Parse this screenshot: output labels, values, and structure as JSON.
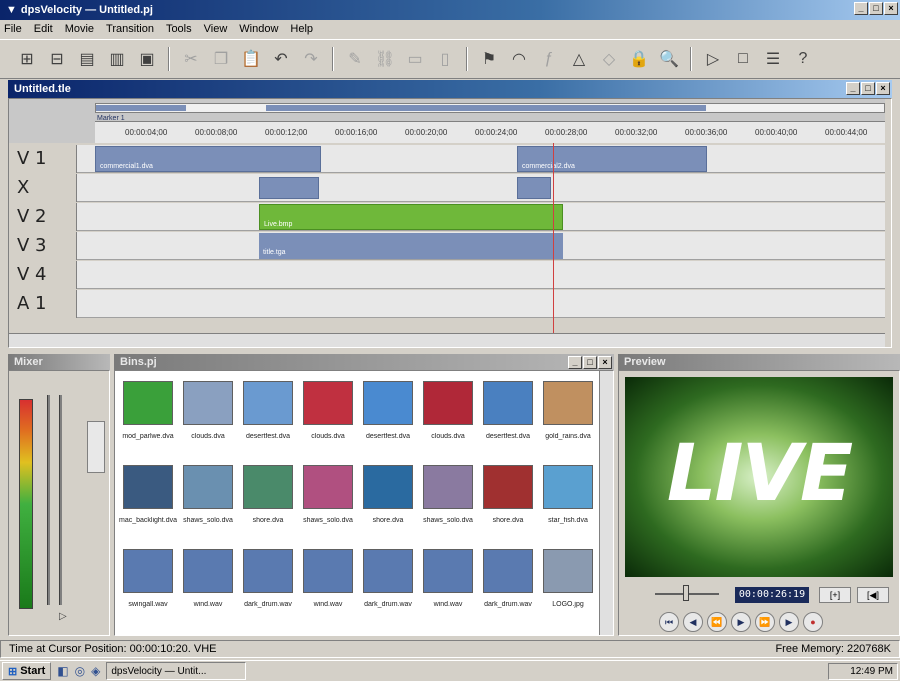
{
  "app": {
    "title": "dpsVelocity — Untitled.pj",
    "menus": [
      "File",
      "Edit",
      "Movie",
      "Transition",
      "Tools",
      "View",
      "Window",
      "Help"
    ]
  },
  "timeline": {
    "title": "Untitled.tle",
    "marker_label": "Marker 1",
    "ruler_ticks": [
      "00:00:04;00",
      "00:00:08;00",
      "00:00:12;00",
      "00:00:16;00",
      "00:00:20;00",
      "00:00:24;00",
      "00:00:28;00",
      "00:00:32;00",
      "00:00:36;00",
      "00:00:40;00",
      "00:00:44;00"
    ],
    "tracks": [
      {
        "label": "V 1"
      },
      {
        "label": "X"
      },
      {
        "label": "V 2"
      },
      {
        "label": "V 3"
      },
      {
        "label": "V 4"
      },
      {
        "label": "A 1"
      }
    ],
    "clips": {
      "v1_a": "commercial1.dva",
      "v1_b": "commercial2.dva",
      "v2": "Live.bmp",
      "v3": "title.tga"
    }
  },
  "mixer": {
    "title": "Mixer"
  },
  "bin": {
    "title": "Bins.pj",
    "items": [
      {
        "caption": "mod_parlwe.dva",
        "color": "#3aa03a"
      },
      {
        "caption": "clouds.dva",
        "color": "#8aa0c0"
      },
      {
        "caption": "desertfest.dva",
        "color": "#6a9ad0"
      },
      {
        "caption": "clouds.dva",
        "color": "#c03040"
      },
      {
        "caption": "desertfest.dva",
        "color": "#4a8ad0"
      },
      {
        "caption": "clouds.dva",
        "color": "#b02838"
      },
      {
        "caption": "desertfest.dva",
        "color": "#4a80c0"
      },
      {
        "caption": "gold_rains.dva",
        "color": "#c09060"
      },
      {
        "caption": "mac_backlight.dva",
        "color": "#3a5a80"
      },
      {
        "caption": "shaws_solo.dva",
        "color": "#6a90b0"
      },
      {
        "caption": "shore.dva",
        "color": "#4a8a6a"
      },
      {
        "caption": "shaws_solo.dva",
        "color": "#b05080"
      },
      {
        "caption": "shore.dva",
        "color": "#2a6aa0"
      },
      {
        "caption": "shaws_solo.dva",
        "color": "#8a7aa0"
      },
      {
        "caption": "shore.dva",
        "color": "#a03030"
      },
      {
        "caption": "star_fish.dva",
        "color": "#5aa0d0"
      },
      {
        "caption": "swingall.wav",
        "color": "#5a7ab0"
      },
      {
        "caption": "wind.wav",
        "color": "#5a7ab0"
      },
      {
        "caption": "dark_drum.wav",
        "color": "#5a7ab0"
      },
      {
        "caption": "wind.wav",
        "color": "#5a7ab0"
      },
      {
        "caption": "dark_drum.wav",
        "color": "#5a7ab0"
      },
      {
        "caption": "wind.wav",
        "color": "#5a7ab0"
      },
      {
        "caption": "dark_drum.wav",
        "color": "#5a7ab0"
      },
      {
        "caption": "LOGO.jpg",
        "color": "#8a9ab0"
      }
    ]
  },
  "preview": {
    "title": "Preview",
    "screen_text": "LIVE",
    "timecode": "00:00:26:19"
  },
  "status": {
    "left": "Time at Cursor Position: 00:00:10:20. VHE",
    "right": "Free Memory: 220768K"
  },
  "taskbar": {
    "start": "Start",
    "task": "dpsVelocity — Untit...",
    "clock": "12:49 PM"
  }
}
